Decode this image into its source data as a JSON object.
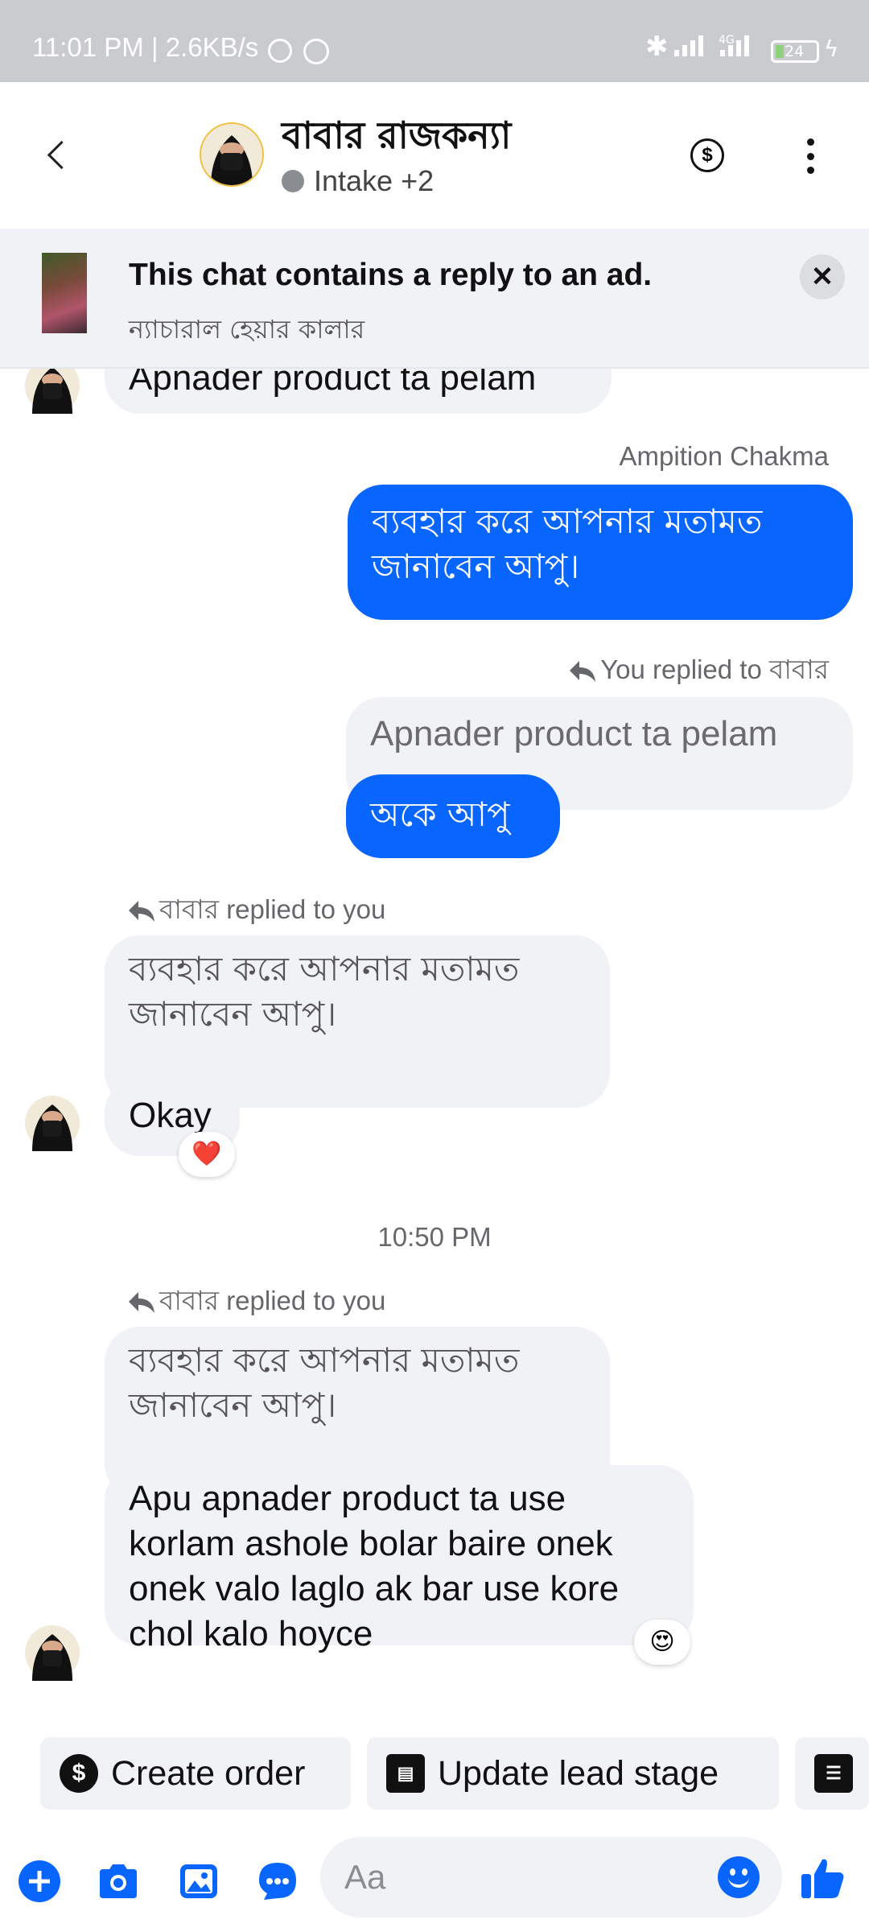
{
  "status_bar": {
    "time_speed": "11:01 PM | 2.6KB/s",
    "network_1": "4G",
    "battery": "24"
  },
  "header": {
    "contact_name": "বাবার রাজকন্যা",
    "status_label": "Intake +2"
  },
  "ad_banner": {
    "title": "This chat contains a reply to an ad.",
    "subtitle": "ন্যাচারাল হেয়ার কালার"
  },
  "messages": {
    "m1_text": "Apnader product ta pelam",
    "m2_sender": "Ampition Chakma",
    "m2_line1": "ব্যবহার করে আপনার মতামত",
    "m2_line2": "জানাবেন আপু।",
    "m3_reply_hint": "You replied to বাবার",
    "m3_quoted": "Apnader product ta pelam",
    "m3_text": "অকে আপু",
    "m4_reply_hint": "বাবার replied to you",
    "m4_quoted_line1": "ব্যবহার করে আপনার মতামত",
    "m4_quoted_line2": "জানাবেন আপু।",
    "m4_text": "Okay",
    "m4_reaction": "❤️",
    "timestamp": "10:50 PM",
    "m5_reply_hint": "বাবার replied to you",
    "m5_quoted_line1": "ব্যবহার করে আপনার মতামত",
    "m5_quoted_line2": "জানাবেন আপু।",
    "m5_line1": "Apu apnader product ta use",
    "m5_line2": "korlam ashole bolar baire onek",
    "m5_line3": "onek valo laglo ak bar use kore",
    "m5_line4": "chol kalo hoyce",
    "m5_reaction": "😍"
  },
  "quick_actions": {
    "create_order": "Create order",
    "update_lead": "Update lead stage"
  },
  "composer": {
    "placeholder": "Aa"
  },
  "colors": {
    "accent": "#0866ff",
    "incoming_bubble": "#f0f2f5",
    "muted_text": "#65676b"
  }
}
